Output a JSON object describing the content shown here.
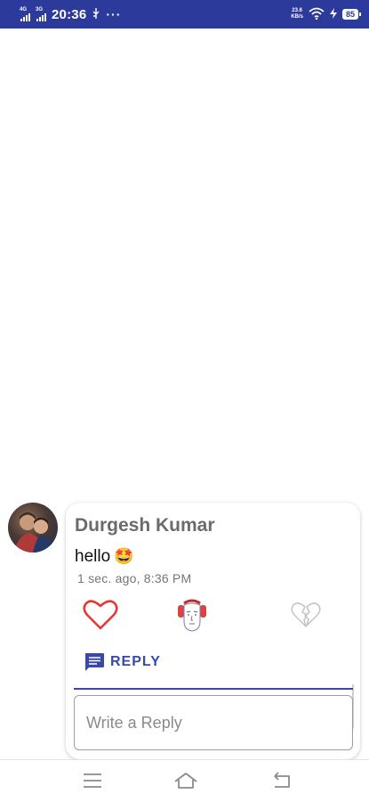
{
  "status_bar": {
    "network_top": "4G",
    "network_bottom": "3G",
    "time": "20:36",
    "usb_icon": "usb-icon",
    "more_dots": "···",
    "speed_value": "23.6",
    "speed_unit": "KB/s",
    "battery_level": "85",
    "colors": {
      "background": "#2c3a9c",
      "text": "#ffffff"
    }
  },
  "comment": {
    "author": "Durgesh Kumar",
    "text": "hello",
    "emoji": "🤩",
    "time": "1 sec. ago, 8:36 PM",
    "avatar_icon": "user-avatar-photo"
  },
  "reactions": [
    {
      "name": "love",
      "icon": "heart-outline-icon",
      "color": "#e53935"
    },
    {
      "name": "face",
      "icon": "headphone-face-icon",
      "color": "#c62828"
    },
    {
      "name": "broken-heart",
      "icon": "broken-heart-icon",
      "color": "#bdbdbd"
    }
  ],
  "reply": {
    "button_label": "REPLY",
    "button_icon": "comment-icon",
    "input_value": "",
    "input_placeholder": "Write a Reply"
  },
  "nav_bar": {
    "menu_icon": "menu-icon",
    "home_icon": "home-icon",
    "back_icon": "back-icon"
  },
  "colors": {
    "accent": "#3949ab",
    "author_text": "#6b6b6b",
    "timestamp_text": "#757575"
  }
}
